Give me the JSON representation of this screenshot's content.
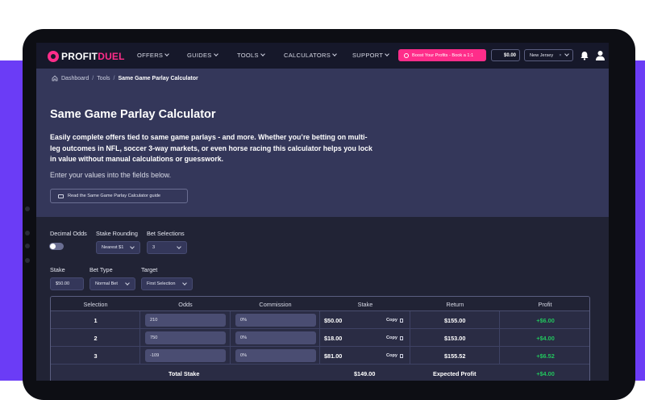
{
  "brand": {
    "name_a": "PROFIT",
    "name_b": "DUEL"
  },
  "nav": [
    {
      "label": "OFFERS"
    },
    {
      "label": "GUIDES"
    },
    {
      "label": "TOOLS"
    },
    {
      "label": "CALCULATORS"
    },
    {
      "label": "SUPPORT"
    }
  ],
  "header": {
    "boost_label": "Boost Your Profits - Book a 1:1",
    "balance": "$0.00",
    "state": "New Jersey"
  },
  "breadcrumb": {
    "home": "Dashboard",
    "tools": "Tools",
    "current": "Same Game Parlay Calculator"
  },
  "hero": {
    "title": "Same Game Parlay Calculator",
    "description": "Easily complete offers tied to same game parlays - and more. Whether you’re betting on multi-leg outcomes in NFL, soccer 3-way markets, or even horse racing this calculator helps you lock in value without manual calculations or guesswork.",
    "instruction": "Enter your values into the fields below.",
    "guide_button": "Read the Same Game Parlay Calculator guide"
  },
  "settings": {
    "decimal_odds_label": "Decimal Odds",
    "decimal_odds_on": false,
    "stake_rounding_label": "Stake Rounding",
    "stake_rounding_value": "Nearest $1",
    "bet_selections_label": "Bet Selections",
    "bet_selections_value": "3",
    "stake_label": "Stake",
    "stake_value": "$50.00",
    "bet_type_label": "Bet Type",
    "bet_type_value": "Normal Bet",
    "target_label": "Target",
    "target_value": "First Selection"
  },
  "table": {
    "headers": [
      "Selection",
      "Odds",
      "Commission",
      "Stake",
      "Return",
      "Profit"
    ],
    "copy_label": "Copy",
    "rows": [
      {
        "selection": "1",
        "odds": "210",
        "commission": "0%",
        "stake": "$50.00",
        "return": "$155.00",
        "profit": "+$6.00"
      },
      {
        "selection": "2",
        "odds": "750",
        "commission": "0%",
        "stake": "$18.00",
        "return": "$153.00",
        "profit": "+$4.00"
      },
      {
        "selection": "3",
        "odds": "-109",
        "commission": "0%",
        "stake": "$81.00",
        "return": "$155.52",
        "profit": "+$6.52"
      }
    ],
    "footer": {
      "total_stake_label": "Total Stake",
      "total_stake": "$149.00",
      "expected_profit_label": "Expected Profit",
      "expected_profit": "+$4.00"
    }
  },
  "colors": {
    "accent": "#ff2d8a",
    "background": "#6b3cf6",
    "profit_positive": "#22c55e"
  }
}
